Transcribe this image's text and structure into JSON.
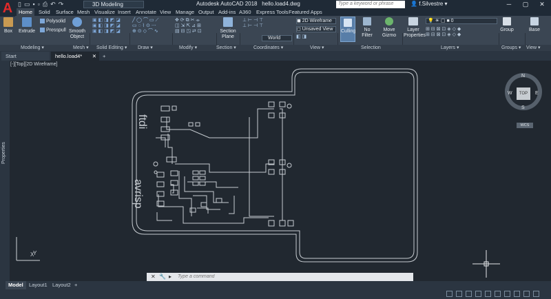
{
  "app": {
    "logo": "A",
    "title": "Autodesk AutoCAD 2018",
    "filename": "hello.load4.dwg"
  },
  "quick_access": {
    "workspace": "3D Modeling"
  },
  "search": {
    "placeholder": "Type a keyword or phrase"
  },
  "user": {
    "name": "f.Silvestre"
  },
  "ribbon_tabs": [
    "Home",
    "Solid",
    "Surface",
    "Mesh",
    "Visualize",
    "Insert",
    "Annotate",
    "View",
    "Manage",
    "Output",
    "Add-ins",
    "A360",
    "Express Tools",
    "Featured Apps"
  ],
  "ribbon": {
    "box": "Box",
    "extrude": "Extrude",
    "polysolid": "Polysolid",
    "presspull": "Presspull",
    "smooth_object": "Smooth Object",
    "section_plane": "Section Plane",
    "visual_style": "2D Wireframe",
    "view_state": "Unsaved View",
    "ucs": "World",
    "culling": "Culling",
    "no_filter": "No Filter",
    "move_gizmo": "Move Gizmo",
    "layer_properties": "Layer Properties",
    "layer_current": "0",
    "group": "Group",
    "base": "Base"
  },
  "panel_labels": [
    "Modeling",
    "Mesh",
    "Solid Editing",
    "Draw",
    "Modify",
    "Section",
    "Coordinates",
    "View",
    "Selection",
    "Layers",
    "Groups",
    "View"
  ],
  "doc_tabs": {
    "start": "Start",
    "current": "hello.load4*"
  },
  "viewport": {
    "label": "[-][Top][2D Wireframe]",
    "viewcube_face": "TOP",
    "compass": {
      "n": "N",
      "s": "S",
      "e": "E",
      "w": "W"
    },
    "wcs": "WCS",
    "pcb_text1": "ftdi",
    "pcb_text2": "avrisp",
    "ucs_x": "X",
    "ucs_y": "Y"
  },
  "side_palette": {
    "label": "Properties"
  },
  "command": {
    "placeholder": "Type a command"
  },
  "layout_tabs": [
    "Model",
    "Layout1",
    "Layout2"
  ]
}
